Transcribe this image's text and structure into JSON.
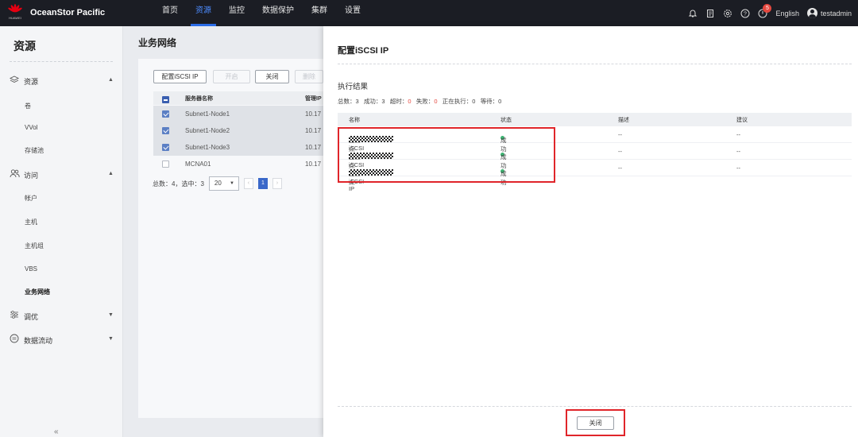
{
  "app": {
    "brand": "OceanStor Pacific",
    "logo_text": "HUAWEI",
    "nav": [
      "首页",
      "资源",
      "监控",
      "数据保护",
      "集群",
      "设置"
    ],
    "active_nav_index": 1,
    "notification_count": "5",
    "language": "English",
    "username": "testadmin"
  },
  "sidebar": {
    "title": "资源",
    "groups": [
      {
        "label": "资源",
        "icon": "layers-icon",
        "chevron": "▲"
      },
      {
        "label": "访问",
        "icon": "users-icon",
        "chevron": "▲"
      },
      {
        "label": "调优",
        "icon": "sliders-icon",
        "chevron": "▼"
      },
      {
        "label": "数据流动",
        "icon": "data-flow-icon",
        "chevron": "▼"
      }
    ],
    "items": [
      "卷",
      "VVol",
      "存储池",
      "帐户",
      "主机",
      "主机组",
      "VBS",
      "业务网络"
    ],
    "active_item": "业务网络",
    "collapse_glyph": "«"
  },
  "page": {
    "title": "业务网络",
    "toolbar": {
      "config_iscsi": "配置iSCSI IP",
      "start": "开启",
      "close": "关闭",
      "delete": "删除"
    },
    "table": {
      "headers": {
        "name": "服务器名称",
        "ip": "管理IP"
      },
      "rows": [
        {
          "name": "Subnet1-Node1",
          "ip": "10.17",
          "selected": true
        },
        {
          "name": "Subnet1-Node2",
          "ip": "10.17",
          "selected": true
        },
        {
          "name": "Subnet1-Node3",
          "ip": "10.17",
          "selected": true
        },
        {
          "name": "MCNA01",
          "ip": "10.17",
          "selected": false
        }
      ]
    },
    "pager": {
      "summary": "总数：4，选中：3",
      "page_size": "20",
      "current_page": "1"
    }
  },
  "dialog": {
    "title": "配置iSCSI IP",
    "section_title": "执行结果",
    "summary": {
      "total": "总数：3",
      "success": "成功：3",
      "timeout_label": "超时：",
      "timeout_value": "0",
      "failed_label": "失败：",
      "failed_value": "0",
      "running": "正在执行：0",
      "waiting": "等待：0"
    },
    "columns": {
      "name": "名称",
      "status": "状态",
      "description": "描述",
      "suggestion": "建议"
    },
    "rows": [
      {
        "prefix": "节点",
        "middle": "配置iSCSI IP",
        "status": "成功",
        "description": "--",
        "suggestion": "--"
      },
      {
        "prefix": "节点",
        "middle": "配置iSCSI IP",
        "status": "成功",
        "description": "--",
        "suggestion": "--"
      },
      {
        "prefix": "节点",
        "middle": "配置iSCSI IP",
        "status": "成功",
        "description": "--",
        "suggestion": "--"
      }
    ],
    "close_button": "关闭"
  },
  "colors": {
    "topbar": "#1b1d24",
    "accent": "#2b6ce6",
    "success": "#3cb371",
    "error": "#e5483f",
    "highlight": "#e0252a"
  }
}
